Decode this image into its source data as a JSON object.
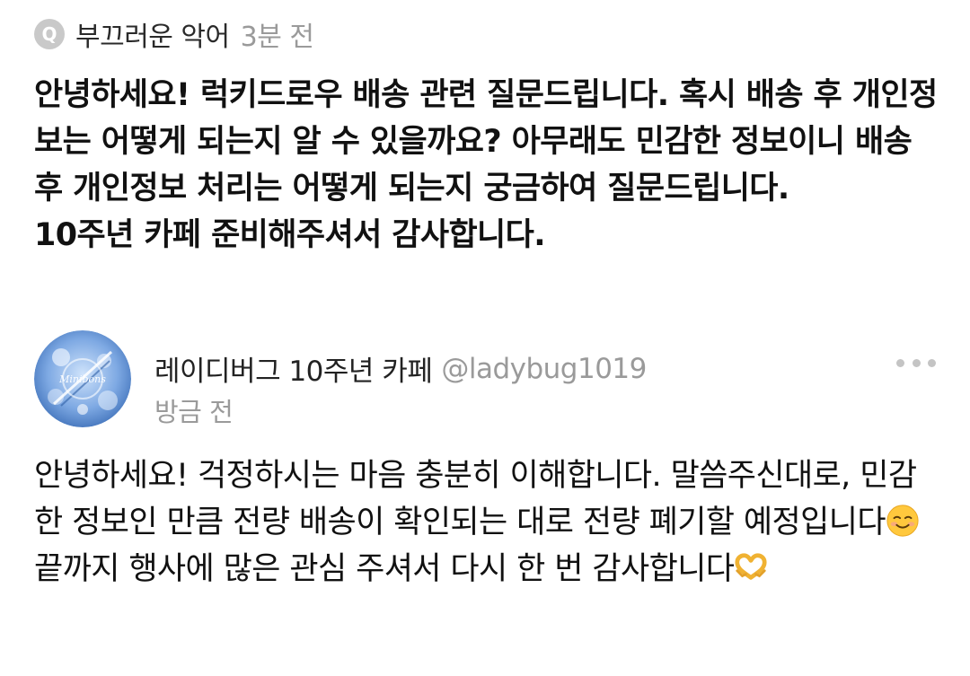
{
  "question": {
    "icon_letter": "Q",
    "asker_name": "부끄러운 악어",
    "time": "3분 전",
    "lines": [
      "안녕하세요! 럭키드로우 배송 관련 질문드립니다. 혹시 배송 후 개인정보는 어떻게 되는지 알 수 있을까요? 아무래도 민감한 정보이니 배송 후 개인정보 처리는 어떻게 되는지 궁금하여 질문드립니다.",
      "10주년 카페 준비해주셔서 감사합니다."
    ]
  },
  "reply": {
    "avatar_text": "Minibons",
    "author_name": "레이디버그 10주년 카페",
    "handle": "@ladybug1019",
    "time": "방금 전",
    "text_part1": "안녕하세요! 걱정하시는 마음 충분히 이해합니다. 말씀주신대로, 민감한 정보인 만큼 전량 배송이 확인되는 대로 전량 폐기할 예정입니다",
    "emoji1": "smiling-face-icon",
    "text_part2": " 끝까지 행사에 많은 관심 주셔서 다시 한 번 감사합니다",
    "emoji2": "heart-hands-icon"
  },
  "colors": {
    "muted": "#9a9a9a",
    "text": "#111111",
    "q_icon_bg": "#c9c9c9",
    "avatar_blue": "#5f8fd1"
  }
}
